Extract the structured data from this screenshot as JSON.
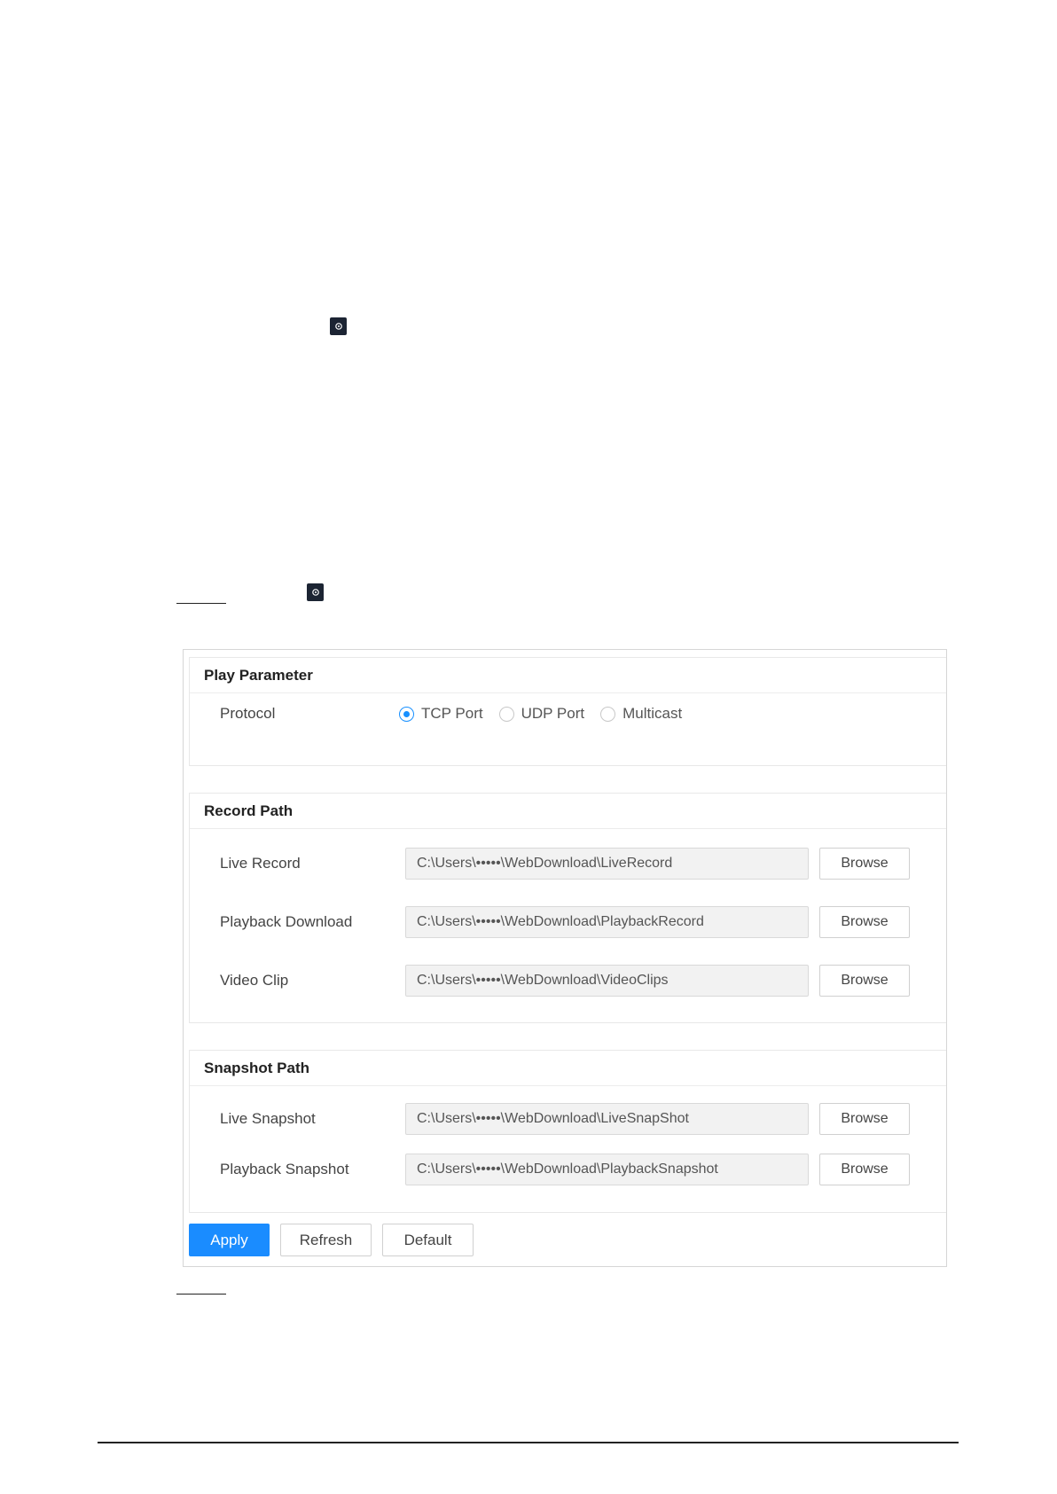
{
  "icons": {
    "settings": "gear-icon"
  },
  "colors": {
    "accent": "#1a8cff",
    "icon_bg": "#1c2433"
  },
  "play_parameter": {
    "title": "Play Parameter",
    "protocol_label": "Protocol",
    "options": [
      "TCP Port",
      "UDP Port",
      "Multicast"
    ],
    "selected": "TCP Port"
  },
  "record_path": {
    "title": "Record Path",
    "rows": [
      {
        "label": "Live Record",
        "value": "C:\\Users\\•••••\\WebDownload\\LiveRecord",
        "button": "Browse"
      },
      {
        "label": "Playback Download",
        "value": "C:\\Users\\•••••\\WebDownload\\PlaybackRecord",
        "button": "Browse"
      },
      {
        "label": "Video Clip",
        "value": "C:\\Users\\•••••\\WebDownload\\VideoClips",
        "button": "Browse"
      }
    ]
  },
  "snapshot_path": {
    "title": "Snapshot Path",
    "rows": [
      {
        "label": "Live Snapshot",
        "value": "C:\\Users\\•••••\\WebDownload\\LiveSnapShot",
        "button": "Browse"
      },
      {
        "label": "Playback Snapshot",
        "value": "C:\\Users\\•••••\\WebDownload\\PlaybackSnapshot",
        "button": "Browse"
      }
    ]
  },
  "actions": {
    "apply": "Apply",
    "refresh": "Refresh",
    "default": "Default"
  }
}
